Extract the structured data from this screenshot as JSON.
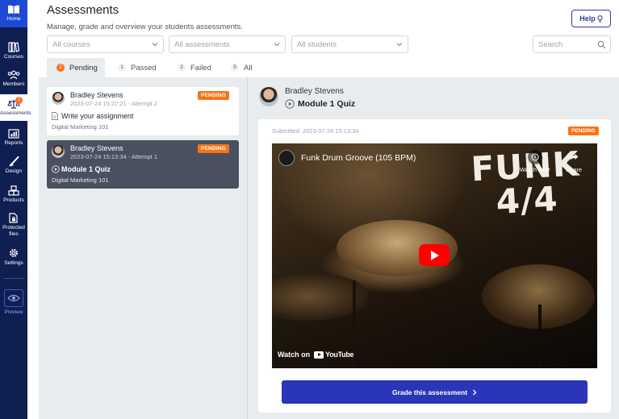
{
  "sidebar": {
    "items": [
      {
        "label": "Home"
      },
      {
        "label": "Courses"
      },
      {
        "label": "Members"
      },
      {
        "label": "Assessments",
        "badge": "2"
      },
      {
        "label": "Reports"
      },
      {
        "label": "Design"
      },
      {
        "label": "Products"
      },
      {
        "label": "Protected files"
      },
      {
        "label": "Settings"
      },
      {
        "label": "Preview"
      }
    ]
  },
  "header": {
    "title": "Assessments",
    "subtitle": "Manage, grade and overview your students assessments.",
    "help_label": "Help"
  },
  "filters": {
    "courses_placeholder": "All courses",
    "assessments_placeholder": "All assessments",
    "students_placeholder": "All students",
    "search_placeholder": "Search"
  },
  "tabs": [
    {
      "label": "Pending",
      "count": "2"
    },
    {
      "label": "Passed",
      "count": "1"
    },
    {
      "label": "Failed",
      "count": "2"
    },
    {
      "label": "All",
      "count": "5"
    }
  ],
  "list": [
    {
      "name": "Bradley Stevens",
      "meta": "2023-07-24 15:22:21 - Attempt 2",
      "title": "Write your assignment",
      "course": "Digital Marketing 101",
      "badge": "PENDING"
    },
    {
      "name": "Bradley Stevens",
      "meta": "2023-07-24 15:13:34 - Attempt 1",
      "title": "Module 1 Quiz",
      "course": "Digital Marketing 101",
      "badge": "PENDING"
    }
  ],
  "detail": {
    "name": "Bradley Stevens",
    "title": "Module 1 Quiz",
    "submitted": "Submitted: 2023-07-24 15:13:34",
    "badge": "PENDING",
    "video": {
      "title": "Funk Drum Groove (105 BPM)",
      "overlay_line1": "FUNK",
      "overlay_line2": "4/4",
      "watch_later": "Watch later",
      "share": "Share",
      "watch_on": "Watch on",
      "youtube": "YouTube"
    },
    "grade_label": "Grade this assessment"
  },
  "colors": {
    "sidebar": "#101f52",
    "home": "#1e49d6",
    "accent": "#2b35b8",
    "pending": "#f97316"
  }
}
